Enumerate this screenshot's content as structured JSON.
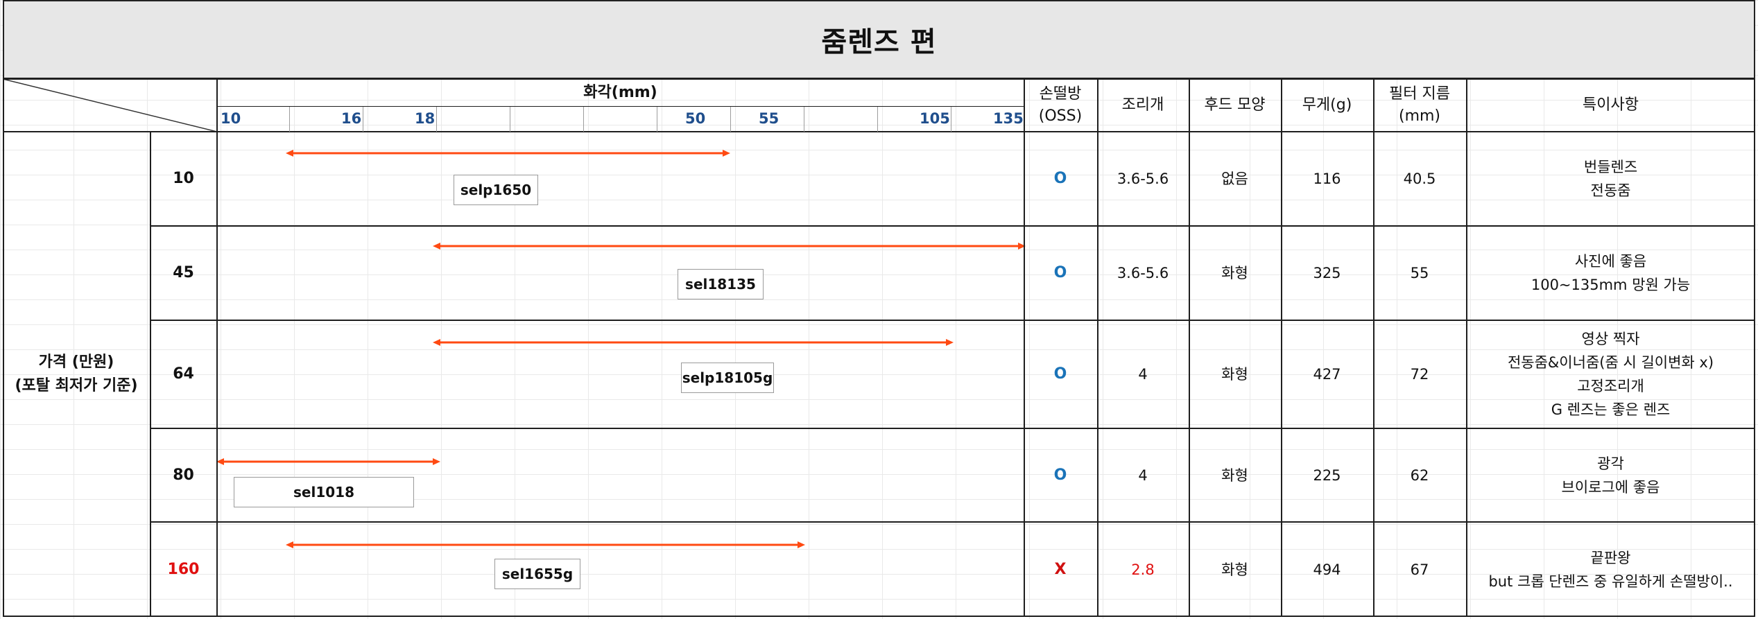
{
  "title": "줌렌즈 편",
  "row_header": {
    "line1": "가격 (만원)",
    "line2": "(포탈 최저가 기준)"
  },
  "columns": {
    "focal": "화각(mm)",
    "oss_line1": "손떨방",
    "oss_line2": "(OSS)",
    "aperture": "조리개",
    "hood": "후드 모양",
    "weight": "무게(g)",
    "filter_line1": "필터 지름",
    "filter_line2": "(mm)",
    "notes": "특이사항"
  },
  "focal_ticks": [
    "10",
    "16",
    "18",
    "50",
    "55",
    "105",
    "135"
  ],
  "rows": [
    {
      "price": "10",
      "price_color": "#111111",
      "lens": "selp1650",
      "focal_min": 16,
      "focal_max": 50,
      "oss": "O",
      "aperture": "3.6-5.6",
      "hood": "없음",
      "weight": "116",
      "filter": "40.5",
      "notes": [
        "번들렌즈",
        "전동줌"
      ]
    },
    {
      "price": "45",
      "price_color": "#111111",
      "lens": "sel18135",
      "focal_min": 18,
      "focal_max": 135,
      "oss": "O",
      "aperture": "3.6-5.6",
      "hood": "화형",
      "weight": "325",
      "filter": "55",
      "notes": [
        "사진에 좋음",
        "100~135mm 망원 가능"
      ]
    },
    {
      "price": "64",
      "price_color": "#111111",
      "lens": "selp18105g",
      "focal_min": 18,
      "focal_max": 105,
      "oss": "O",
      "aperture": "4",
      "hood": "화형",
      "weight": "427",
      "filter": "72",
      "notes": [
        "영상 찍자",
        "전동줌&이너줌(줌 시 길이변화 x)",
        "고정조리개",
        "G 렌즈는 좋은 렌즈"
      ]
    },
    {
      "price": "80",
      "price_color": "#111111",
      "lens": "sel1018",
      "focal_min": 10,
      "focal_max": 18,
      "oss": "O",
      "aperture": "4",
      "hood": "화형",
      "weight": "225",
      "filter": "62",
      "notes": [
        "광각",
        "브이로그에 좋음"
      ]
    },
    {
      "price": "160",
      "price_color": "#e01010",
      "lens": "sel1655g",
      "focal_min": 16,
      "focal_max": 55,
      "oss": "X",
      "aperture": "2.8",
      "hood": "화형",
      "weight": "494",
      "filter": "67",
      "notes": [
        "끝판왕",
        "but 크롭 단렌즈 중 유일하게 손떨방이.."
      ]
    }
  ],
  "colors": {
    "arrow": "#ff4a12",
    "oss_yes": "#1a73b8",
    "oss_no": "#d01010",
    "tick": "#1f4e8c",
    "title_band": "#e7e7e7"
  }
}
